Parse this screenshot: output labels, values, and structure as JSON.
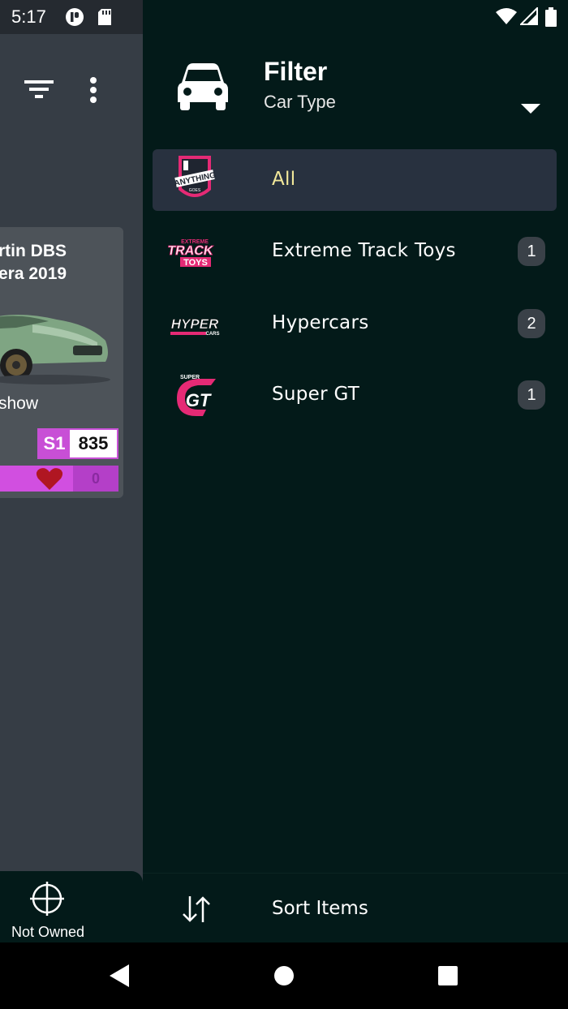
{
  "status_bar": {
    "time": "5:17",
    "icons_left": [
      "app-notification-icon",
      "sd-card-icon"
    ],
    "icons_right": [
      "wifi-icon",
      "cell-signal-icon",
      "battery-icon"
    ]
  },
  "background_app": {
    "toolbar_icons": [
      "filter-list-icon",
      "more-vert-icon"
    ],
    "car_card": {
      "name_line1": "rtin DBS",
      "name_line2": "era 2019",
      "maker": "show",
      "pi_class": "S1",
      "pi_value": "835",
      "favorites": "0"
    },
    "bottom_nav": {
      "not_owned_label": "Not Owned"
    }
  },
  "drawer": {
    "title": "Filter",
    "subtitle": "Car Type",
    "items": [
      {
        "label": "All",
        "count": "",
        "selected": true,
        "logo": "anything-goes-logo"
      },
      {
        "label": "Extreme Track Toys",
        "count": "1",
        "selected": false,
        "logo": "extreme-track-toys-logo"
      },
      {
        "label": "Hypercars",
        "count": "2",
        "selected": false,
        "logo": "hypercars-logo"
      },
      {
        "label": "Super GT",
        "count": "1",
        "selected": false,
        "logo": "super-gt-logo"
      }
    ],
    "sort_label": "Sort Items"
  },
  "colors": {
    "drawer_bg": "#031a19",
    "selected_item_bg": "#28313f",
    "selected_text": "#f2e89a",
    "pi_class_color": "#c84fd6",
    "count_badge_bg": "#3a4148"
  }
}
